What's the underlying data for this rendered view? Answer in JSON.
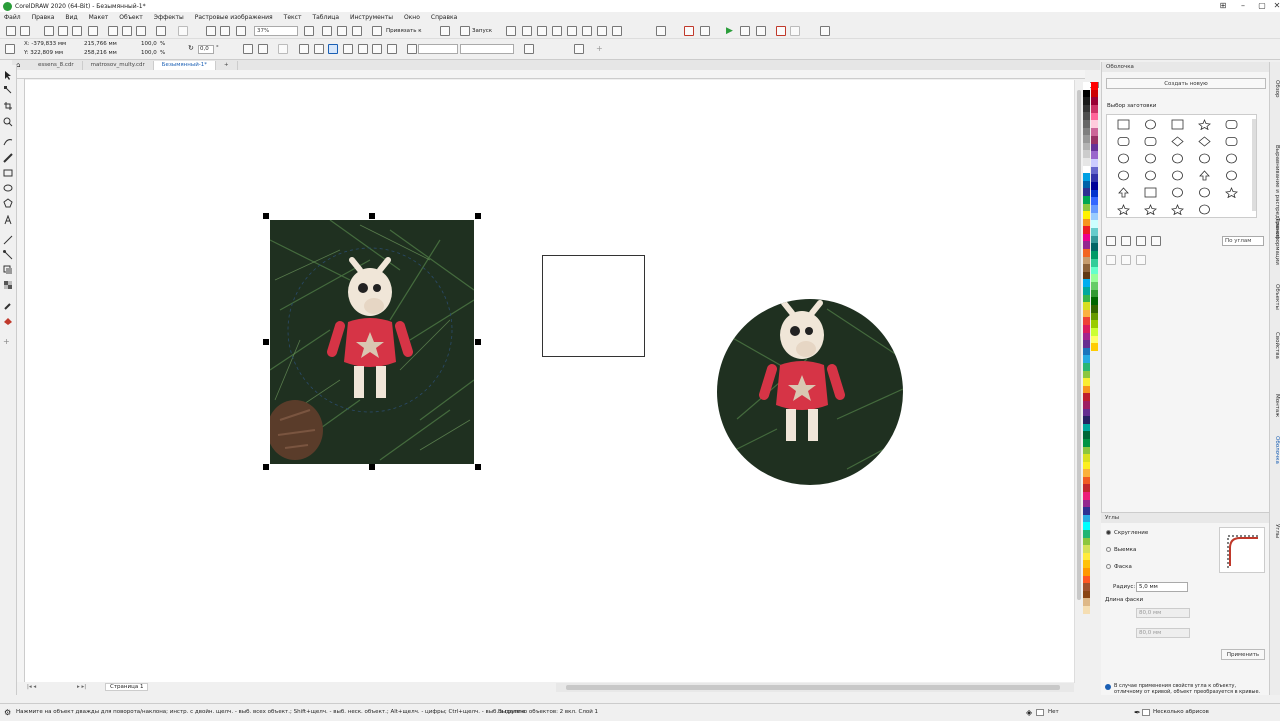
{
  "window": {
    "title": "CorelDRAW 2020 (64-Bit) - Безымянный-1*"
  },
  "menu": [
    "Файл",
    "Правка",
    "Вид",
    "Макет",
    "Объект",
    "Эффекты",
    "Растровые изображения",
    "Текст",
    "Таблица",
    "Инструменты",
    "Окно",
    "Справка"
  ],
  "toolbar": {
    "zoom": "37%",
    "snap_label": "Привязать к",
    "launch_label": "Запуск"
  },
  "propbar": {
    "x": "X: -379,833 мм",
    "y": "Y: 322,809 мм",
    "w": "215,766 мм",
    "h": "258,216 мм",
    "sx": "100,0",
    "sy": "100,0",
    "pct": "%",
    "angle": "0,0",
    "deg": "°"
  },
  "tabs": [
    {
      "label": "essens_8.cdr"
    },
    {
      "label": "matrosov_multy.cdr"
    },
    {
      "label": "Безымянный-1*"
    }
  ],
  "pagebar": {
    "page": "Страница 1"
  },
  "docker_shaping": {
    "title": "Оболочка",
    "create_button": "Создать новую",
    "presets_label": "Выбор заготовки",
    "mode_select": "По углам"
  },
  "docker_corners": {
    "title": "Углы",
    "options": [
      "Скругление",
      "Выемка",
      "Фаска"
    ],
    "radius_label": "Радиус:",
    "radius_value": "5,0 мм",
    "chamfer_label": "Длина фаски",
    "chamfer_a": "80,0 мм",
    "chamfer_b": "80,0 мм",
    "apply_button": "Применить",
    "hint": "В случае применения свойств угла к объекту, отличному от кривой, объект преобразуется в кривые."
  },
  "side_tabs": [
    "Обзор",
    "Выравнивание и распределение",
    "Трансформации",
    "Объекты",
    "Свойства",
    "Монтаж",
    "Оболочка",
    "Углы"
  ],
  "status": {
    "hint": "Нажмите на объект дважды для поворота/наклона; инстр. с двойн. щелч. - выб. всех объект.; Shift+щелч. - выб. неск. объект.; Alt+щелч. - цифры; Ctrl+щелч. - выб. в группе",
    "selection": "Выделено объектов: 2 вкл. Слой 1",
    "fill": "Нет",
    "outline": "Несколько абрисов"
  },
  "colors": {
    "accent": "#1a5fb4",
    "selection": "#000000"
  },
  "palette_colors": [
    "#ffffff",
    "#000000",
    "#1a1a1a",
    "#333333",
    "#4d4d4d",
    "#666666",
    "#808080",
    "#999999",
    "#b3b3b3",
    "#cccccc",
    "#e6e6e6",
    "#ffffff",
    "#00a0e3",
    "#0061a8",
    "#2e3192",
    "#00a651",
    "#8dc63f",
    "#fff200",
    "#f7941d",
    "#ed1c24",
    "#ec008c",
    "#92278f",
    "#f26522",
    "#c69c6d",
    "#8c6239",
    "#603913",
    "#00aeef",
    "#00a99d",
    "#39b54a",
    "#d7df23",
    "#fbb040",
    "#ef4136",
    "#da1c5c",
    "#a3238e",
    "#662d91",
    "#1b75bc",
    "#27aae1",
    "#2bb673",
    "#8dc63f",
    "#f9ed32",
    "#f7941e",
    "#be1e2d",
    "#9e1f63",
    "#652d90",
    "#262262",
    "#00a79d",
    "#006838",
    "#009444",
    "#8cc63f",
    "#d9e021",
    "#fcee21",
    "#fbb03b",
    "#f15a24",
    "#c1272d",
    "#ed1e79",
    "#93278f",
    "#2e3192",
    "#29abe2",
    "#00ffff",
    "#22b573",
    "#8cc63e",
    "#d4e157",
    "#ffeb3b",
    "#ffc107",
    "#ff9800",
    "#ff5722",
    "#a0522d",
    "#8b4513",
    "#deb887",
    "#f5deb3"
  ],
  "palette2_colors": [
    "#ff0000",
    "#cc0000",
    "#990033",
    "#cc3366",
    "#ff6699",
    "#ffccdd",
    "#cc6699",
    "#993366",
    "#663399",
    "#9966cc",
    "#ccccff",
    "#6666cc",
    "#3333aa",
    "#000099",
    "#0033cc",
    "#3366ff",
    "#6699ff",
    "#99ccff",
    "#ccffff",
    "#66cccc",
    "#339999",
    "#006666",
    "#009966",
    "#33cc99",
    "#66ffcc",
    "#99ff99",
    "#66cc66",
    "#339933",
    "#006600",
    "#336600",
    "#669900",
    "#99cc00",
    "#ccff33",
    "#ffff66",
    "#ffcc00"
  ]
}
